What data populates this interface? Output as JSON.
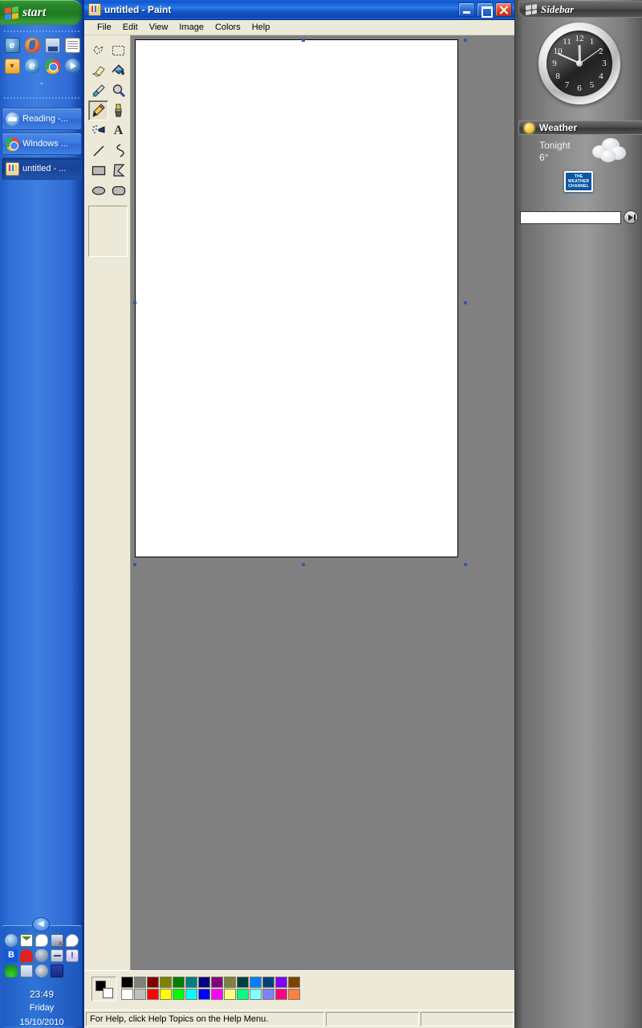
{
  "taskbar": {
    "start_label": "start",
    "start_icon": "windows-flag-icon",
    "quicklaunch": [
      {
        "name": "outlook-express-icon",
        "cls": "ico-outlook"
      },
      {
        "name": "firefox-icon",
        "cls": "ico-firefox"
      },
      {
        "name": "show-desktop-icon",
        "cls": "ico-desktop"
      },
      {
        "name": "notepad-icon",
        "cls": "ico-notepad"
      },
      {
        "name": "mail-icon",
        "cls": "ico-mailorange"
      },
      {
        "name": "internet-explorer-icon",
        "cls": "ico-ie"
      },
      {
        "name": "chrome-icon",
        "cls": "ico-chrome"
      },
      {
        "name": "windows-media-player-icon",
        "cls": "ico-wmp"
      }
    ],
    "quicklaunch_chevron": "ˇ",
    "tasks": [
      {
        "label": "Reading -...",
        "icon": "reading-icon",
        "icon_cls": "ico-reading",
        "active": false
      },
      {
        "label": "Windows ...",
        "icon": "chrome-icon",
        "icon_cls": "ico-chrome",
        "active": false
      },
      {
        "label": "untitled - ...",
        "icon": "paint-icon",
        "icon_cls": "ico-paint",
        "active": true
      }
    ],
    "tray": {
      "chevron": "◀",
      "icons": [
        {
          "name": "network-icon",
          "cls": "t-net"
        },
        {
          "name": "mail-icon",
          "cls": "t-mail"
        },
        {
          "name": "messenger-icon",
          "cls": "t-chat"
        },
        {
          "name": "network-disconnected-icon",
          "cls": "t-netx"
        },
        {
          "name": "speech-bubble-icon",
          "cls": "t-bub"
        },
        {
          "name": "bluetooth-icon",
          "cls": "t-blue"
        },
        {
          "name": "antivirus-heart-icon",
          "cls": "t-heart"
        },
        {
          "name": "security-shield-icon",
          "cls": "t-shield"
        },
        {
          "name": "key-tool-icon",
          "cls": "t-key"
        },
        {
          "name": "microphone-alert-icon",
          "cls": "t-mic"
        },
        {
          "name": "wireless-signal-icon",
          "cls": "t-wifi"
        },
        {
          "name": "display-monitor-icon",
          "cls": "t-mon"
        },
        {
          "name": "volume-speaker-icon",
          "cls": "t-spk"
        },
        {
          "name": "battery-icon",
          "cls": "t-batt"
        }
      ],
      "time": "23:49",
      "day": "Friday",
      "date": "15/10/2010"
    }
  },
  "paint": {
    "title": "untitled - Paint",
    "title_icon": "paint-icon",
    "window_buttons": {
      "minimize": "minimize-button",
      "maximize": "maximize-button",
      "close": "close-button"
    },
    "menu": [
      "File",
      "Edit",
      "View",
      "Image",
      "Colors",
      "Help"
    ],
    "tools": [
      {
        "name": "free-form-select-tool",
        "selected": false
      },
      {
        "name": "rectangular-select-tool",
        "selected": false
      },
      {
        "name": "eraser-tool",
        "selected": false
      },
      {
        "name": "fill-with-color-tool",
        "selected": false
      },
      {
        "name": "pick-color-tool",
        "selected": false
      },
      {
        "name": "magnifier-tool",
        "selected": false
      },
      {
        "name": "pencil-tool",
        "selected": true
      },
      {
        "name": "brush-tool",
        "selected": false
      },
      {
        "name": "airbrush-tool",
        "selected": false
      },
      {
        "name": "text-tool",
        "selected": false
      },
      {
        "name": "line-tool",
        "selected": false
      },
      {
        "name": "curve-tool",
        "selected": false
      },
      {
        "name": "rectangle-tool",
        "selected": false
      },
      {
        "name": "polygon-tool",
        "selected": false
      },
      {
        "name": "ellipse-tool",
        "selected": false
      },
      {
        "name": "rounded-rectangle-tool",
        "selected": false
      }
    ],
    "canvas": {
      "background": "#ffffff",
      "workspace": "#808080"
    },
    "colors": {
      "foreground": "#000000",
      "background": "#ffffff",
      "palette_row1": [
        "#000000",
        "#808080",
        "#800000",
        "#808000",
        "#008000",
        "#008080",
        "#000080",
        "#800080",
        "#808040",
        "#004040",
        "#0080ff",
        "#004080",
        "#8000ff",
        "#804000"
      ],
      "palette_row2": [
        "#ffffff",
        "#c0c0c0",
        "#ff0000",
        "#ffff00",
        "#00ff00",
        "#00ffff",
        "#0000ff",
        "#ff00ff",
        "#ffff80",
        "#00ff80",
        "#80ffff",
        "#8080ff",
        "#ff0080",
        "#ff8040"
      ]
    },
    "statusbar": {
      "help": "For Help, click Help Topics on the Help Menu.",
      "coords": "",
      "size": ""
    }
  },
  "sidebar": {
    "title": "Sidebar",
    "title_icon": "windows-flag-icon",
    "clock": {
      "name": "analog-clock-gadget",
      "numbers": [
        "12",
        "1",
        "2",
        "3",
        "4",
        "5",
        "6",
        "7",
        "8",
        "9",
        "10",
        "11"
      ],
      "hour_deg": 359,
      "minute_deg": 294,
      "second_deg": 55
    },
    "weather": {
      "title": "Weather",
      "when": "Tonight",
      "temp": "6°",
      "condition_icon": "cloudy-icon",
      "logo_lines": [
        "THE",
        "WEATHER",
        "CHANNEL"
      ],
      "logo_url": "weather.com"
    },
    "search": {
      "value": "",
      "placeholder": "",
      "go_icon": "play-arrow-icon"
    }
  }
}
